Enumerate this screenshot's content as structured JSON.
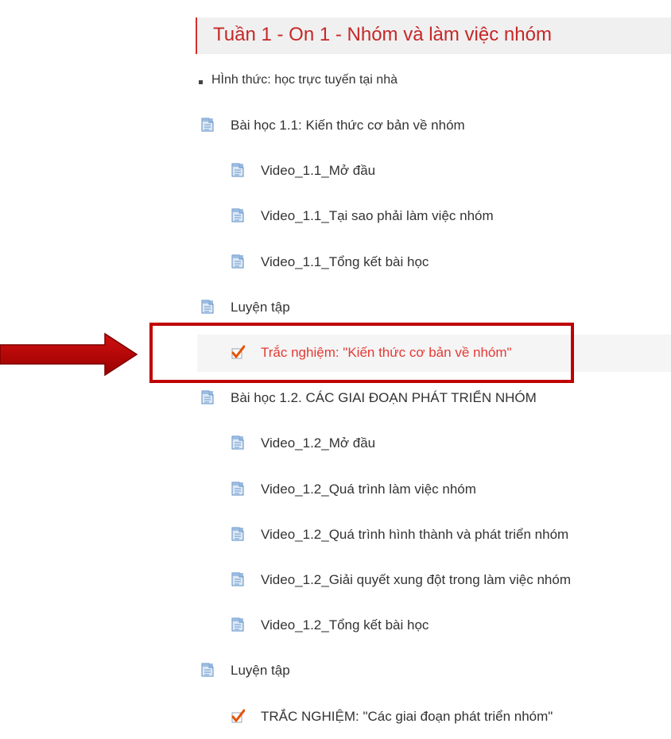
{
  "section": {
    "title": "Tuần 1 - On 1 - Nhóm và làm việc nhóm",
    "accent_color": "#c62828"
  },
  "summary": {
    "text": "HÌnh thức: học trực tuyến tại nhà"
  },
  "items": [
    {
      "label": "Bài học 1.1: Kiến thức cơ bản về nhóm",
      "icon": "page-icon",
      "indent": 0
    },
    {
      "label": "Video_1.1_Mở đầu",
      "icon": "page-icon",
      "indent": 1
    },
    {
      "label": "Video_1.1_Tại sao phải làm việc nhóm",
      "icon": "page-icon",
      "indent": 1
    },
    {
      "label": "Video_1.1_Tổng kết bài học",
      "icon": "page-icon",
      "indent": 1
    },
    {
      "label": "Luyện tập",
      "icon": "page-icon",
      "indent": 0
    },
    {
      "label": "Trắc nghiệm: \"Kiến thức cơ bản về nhóm\"",
      "icon": "quiz-check-icon",
      "indent": 1,
      "highlighted": true
    },
    {
      "label": "Bài học 1.2. CÁC GIAI ĐOẠN PHÁT TRIỂN NHÓM",
      "icon": "page-icon",
      "indent": 0
    },
    {
      "label": "Video_1.2_Mở đầu",
      "icon": "page-icon",
      "indent": 1
    },
    {
      "label": "Video_1.2_Quá trình làm việc nhóm",
      "icon": "page-icon",
      "indent": 1
    },
    {
      "label": "Video_1.2_Quá trình hình thành và phát triển nhóm",
      "icon": "page-icon",
      "indent": 1
    },
    {
      "label": "Video_1.2_Giải quyết xung đột trong làm việc nhóm",
      "icon": "page-icon",
      "indent": 1
    },
    {
      "label": "Video_1.2_Tổng kết bài học",
      "icon": "page-icon",
      "indent": 1
    },
    {
      "label": "Luyện tập",
      "icon": "page-icon",
      "indent": 0
    },
    {
      "label": "TRẮC NGHIỆM: \"Các giai đoạn phát triển nhóm\"",
      "icon": "quiz-check-icon",
      "indent": 1
    }
  ],
  "annotation": {
    "arrow_color": "#c00000",
    "box_color": "#c00000"
  }
}
